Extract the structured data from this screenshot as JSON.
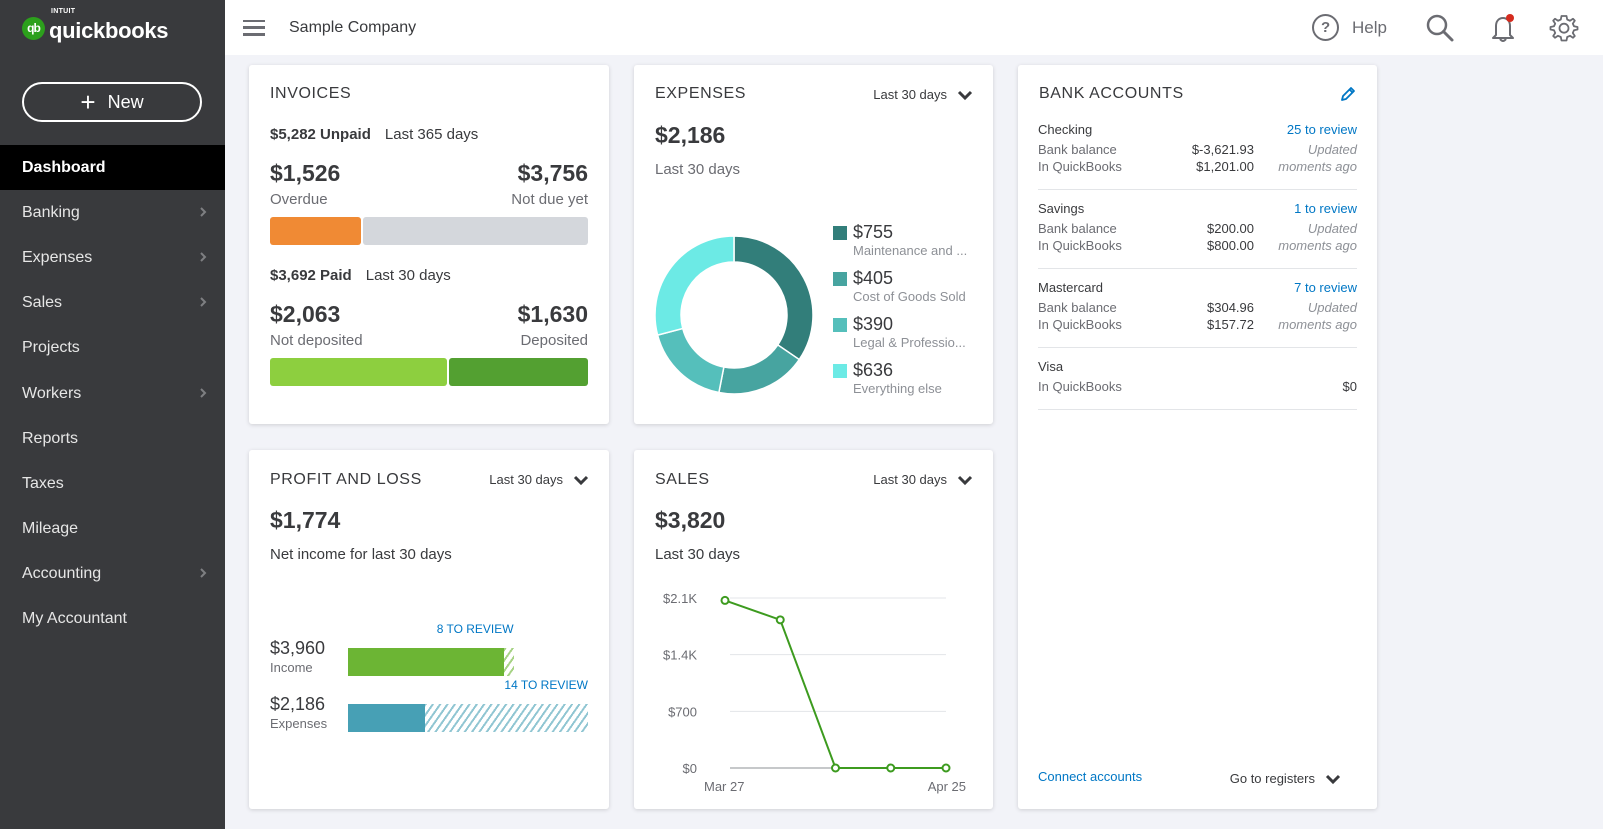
{
  "app": {
    "brand_small": "INTUIT",
    "brand": "quickbooks",
    "brand_badge": "qb",
    "company": "Sample Company"
  },
  "sidebar": {
    "new_label": "New",
    "items": [
      {
        "label": "Dashboard",
        "active": true,
        "chevron": false
      },
      {
        "label": "Banking",
        "chevron": true
      },
      {
        "label": "Expenses",
        "chevron": true
      },
      {
        "label": "Sales",
        "chevron": true
      },
      {
        "label": "Projects",
        "chevron": false
      },
      {
        "label": "Workers",
        "chevron": true
      },
      {
        "label": "Reports",
        "chevron": false
      },
      {
        "label": "Taxes",
        "chevron": false
      },
      {
        "label": "Mileage",
        "chevron": false
      },
      {
        "label": "Accounting",
        "chevron": true
      },
      {
        "label": "My Accountant",
        "chevron": false
      }
    ]
  },
  "header": {
    "help_label": "Help",
    "notification_dot_color": "#d52b1e"
  },
  "invoices": {
    "title": "INVOICES",
    "unpaid_amount": "$5,282 Unpaid",
    "unpaid_period": "Last 365 days",
    "overdue_amount": "$1,526",
    "overdue_label": "Overdue",
    "notdue_amount": "$3,756",
    "notdue_label": "Not due yet",
    "unpaid_bar": {
      "overdue_fraction": 0.289,
      "overdue_color": "#f08a34",
      "rest_color": "#d4d7dc"
    },
    "paid_amount": "$3,692 Paid",
    "paid_period": "Last 30 days",
    "notdeposited_amount": "$2,063",
    "notdeposited_label": "Not deposited",
    "deposited_amount": "$1,630",
    "deposited_label": "Deposited",
    "paid_bar": {
      "notdeposited_fraction": 0.559,
      "notdeposited_color": "#8dcf3f",
      "deposited_color": "#53a031"
    }
  },
  "expenses": {
    "title": "EXPENSES",
    "period": "Last 30 days",
    "total": "$2,186",
    "subtitle": "Last 30 days",
    "categories": [
      {
        "amount": "$755",
        "value": 755,
        "label": "Maintenance and ...",
        "color": "#327e7a"
      },
      {
        "amount": "$405",
        "value": 405,
        "label": "Cost of Goods Sold",
        "color": "#47a4a0"
      },
      {
        "amount": "$390",
        "value": 390,
        "label": "Legal & Professio...",
        "color": "#55bfbb"
      },
      {
        "amount": "$636",
        "value": 636,
        "label": "Everything else",
        "color": "#6ceae5"
      }
    ]
  },
  "bank": {
    "title": "BANK ACCOUNTS",
    "accounts": [
      {
        "name": "Checking",
        "review": "25 to review",
        "bank_label": "Bank balance",
        "bank_value": "$-3,621.93",
        "qb_label": "In QuickBooks",
        "qb_value": "$1,201.00",
        "updated_1": "Updated",
        "updated_2": "moments ago"
      },
      {
        "name": "Savings",
        "review": "1 to review",
        "bank_label": "Bank balance",
        "bank_value": "$200.00",
        "qb_label": "In QuickBooks",
        "qb_value": "$800.00",
        "updated_1": "Updated",
        "updated_2": "moments ago"
      },
      {
        "name": "Mastercard",
        "review": "7 to review",
        "bank_label": "Bank balance",
        "bank_value": "$304.96",
        "qb_label": "In QuickBooks",
        "qb_value": "$157.72",
        "updated_1": "Updated",
        "updated_2": "moments ago"
      },
      {
        "name": "Visa",
        "qb_label": "In QuickBooks",
        "qb_value": "$0"
      }
    ],
    "connect_label": "Connect accounts",
    "registers_label": "Go to registers"
  },
  "pnl": {
    "title": "PROFIT AND LOSS",
    "period": "Last 30 days",
    "net": "$1,774",
    "subtitle": "Net income for last 30 days",
    "income": {
      "amount": "$3,960",
      "label": "Income",
      "review": "8 TO REVIEW",
      "color": "#6cb534",
      "solid_fraction": 0.65,
      "total_fraction": 0.69
    },
    "expense": {
      "amount": "$2,186",
      "label": "Expenses",
      "review": "14 TO REVIEW",
      "color": "#47a0b5",
      "solid_fraction": 0.32,
      "total_fraction": 1.0
    }
  },
  "sales": {
    "title": "SALES",
    "period": "Last 30 days",
    "total": "$3,820",
    "subtitle": "Last 30 days"
  },
  "chart_data": {
    "type": "line",
    "title": "SALES",
    "x": [
      "Mar 27",
      "",
      "",
      "",
      "Apr 25"
    ],
    "x_tick_labels": [
      "Mar 27",
      "Apr 25"
    ],
    "series": [
      {
        "name": "Sales",
        "values": [
          2070,
          1830,
          0,
          0,
          0
        ],
        "color": "#3d9b1f"
      }
    ],
    "yticks": [
      "$0",
      "$700",
      "$1.4K",
      "$2.1K"
    ],
    "ytick_values": [
      0,
      700,
      1400,
      2100
    ],
    "ylim": [
      0,
      2100
    ],
    "grid": true,
    "xlabel": "",
    "ylabel": ""
  }
}
